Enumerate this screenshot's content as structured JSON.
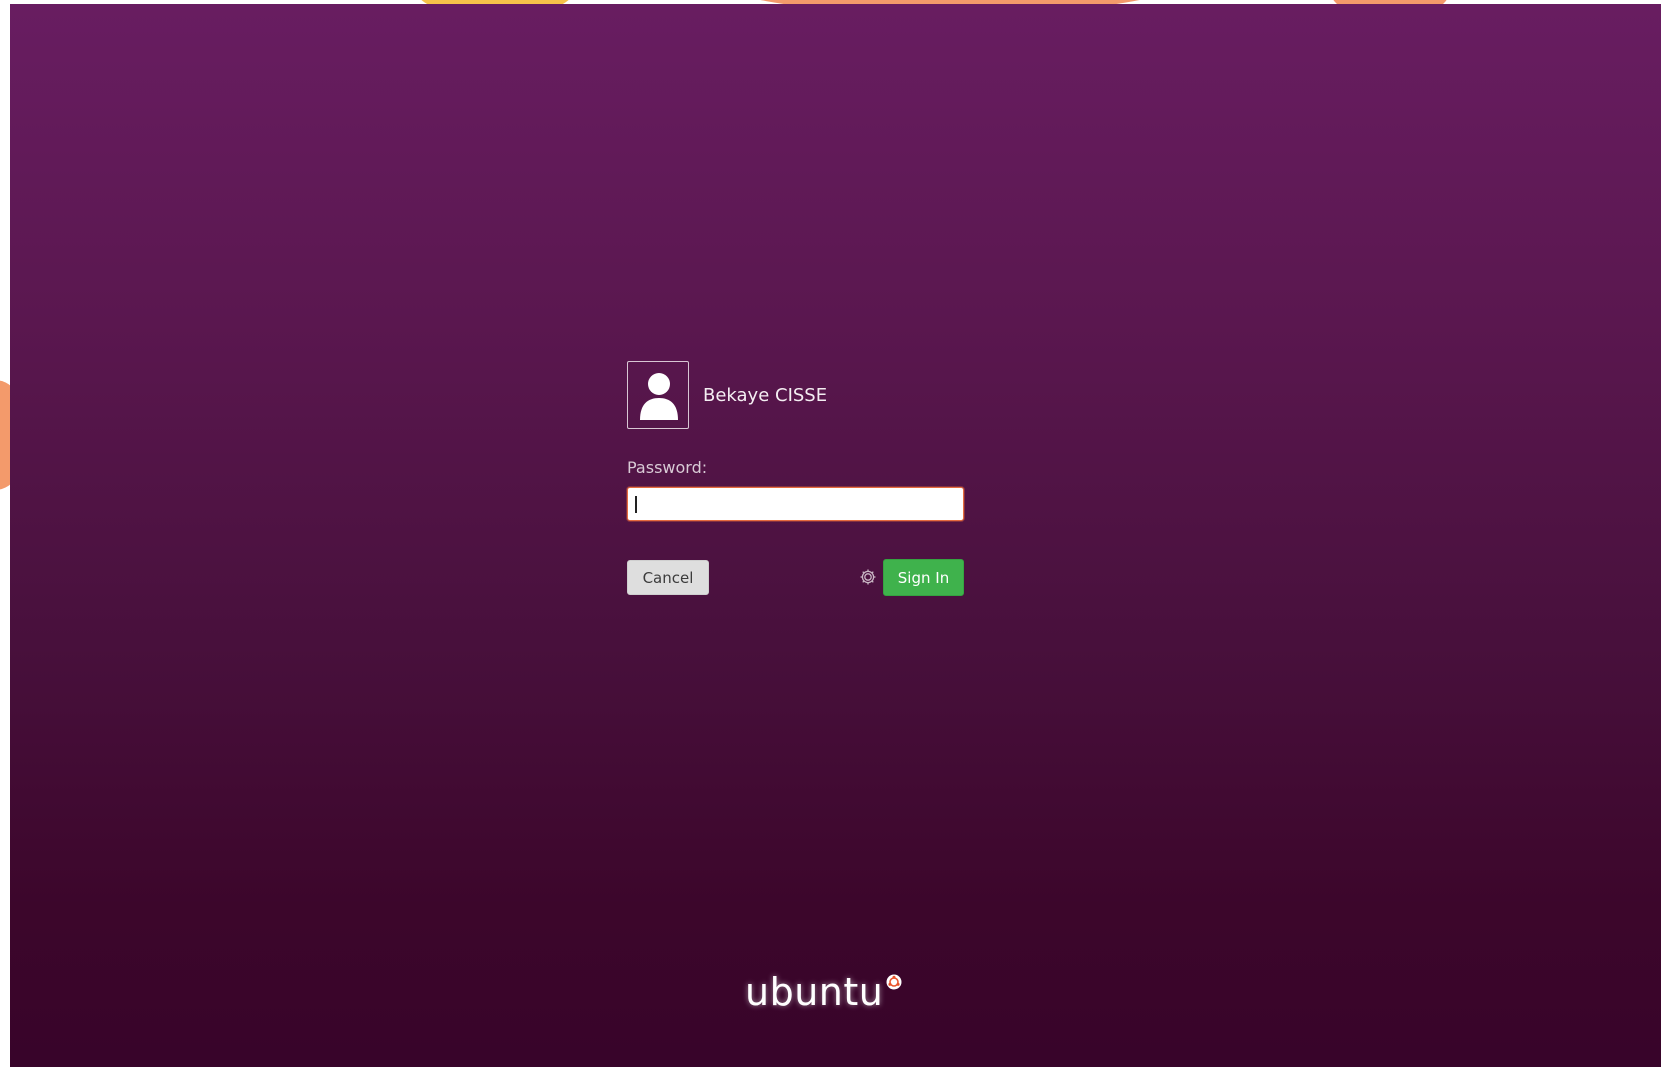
{
  "user": {
    "name": "Bekaye CISSE",
    "avatar_icon": "user-silhouette-icon"
  },
  "password": {
    "label": "Password:",
    "value": ""
  },
  "buttons": {
    "cancel_label": "Cancel",
    "signin_label": "Sign In",
    "session_icon": "gear-icon"
  },
  "branding": {
    "logo_text": "ubuntu",
    "logo_icon": "circle-of-friends-icon"
  },
  "colors": {
    "background_top": "#681d61",
    "background_bottom": "#38042a",
    "signin_green": "#3fb24c",
    "input_focus_border": "#e66b3e"
  }
}
